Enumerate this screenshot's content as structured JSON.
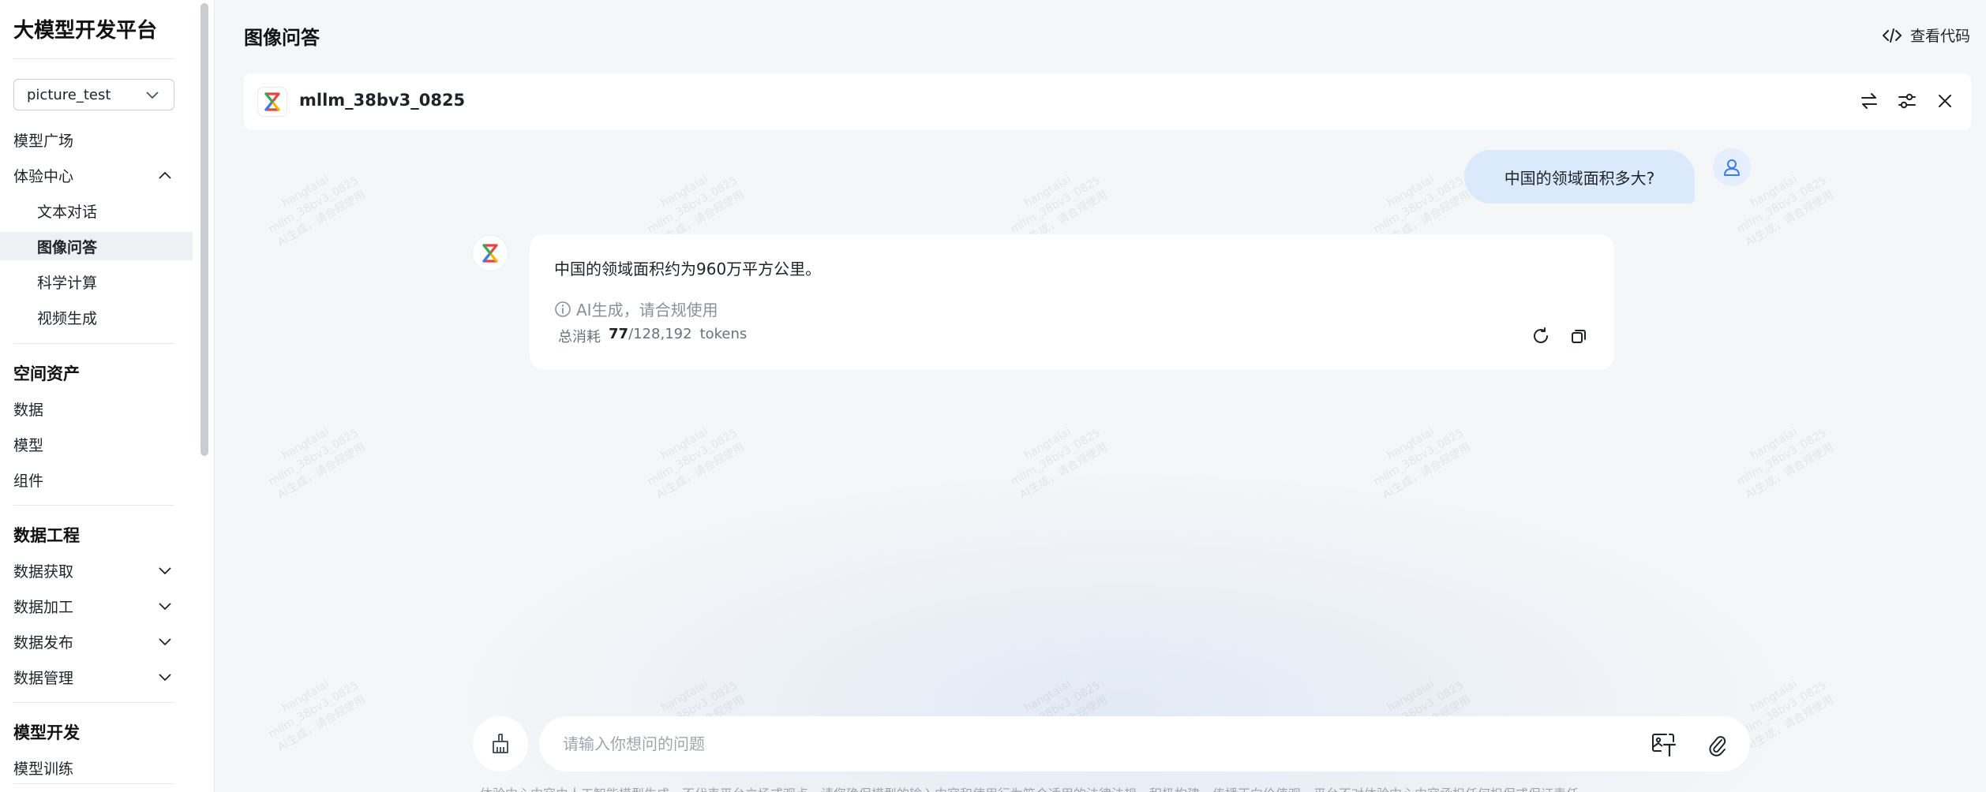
{
  "sidebar": {
    "brand": "大模型开发平台",
    "project": "picture_test",
    "items": {
      "model_square": "模型广场",
      "experience_center": "体验中心",
      "text_chat": "文本对话",
      "image_qa": "图像问答",
      "sci_compute": "科学计算",
      "video_gen": "视频生成"
    },
    "group_space": "空间资产",
    "space_items": [
      "数据",
      "模型",
      "组件"
    ],
    "group_data_eng": "数据工程",
    "data_eng_items": [
      "数据获取",
      "数据加工",
      "数据发布",
      "数据管理"
    ],
    "group_model_dev": "模型开发",
    "model_dev_items": [
      "模型训练"
    ]
  },
  "header": {
    "title": "图像问答",
    "view_code": "查看代码"
  },
  "model_bar": {
    "name": "mllm_38bv3_0825"
  },
  "watermark": {
    "line1": "hangtaiai",
    "line2": "mllm_38bv3_0825",
    "line3": "AI生成，请合规使用"
  },
  "chat": {
    "user_message": "中国的领域面积多大?",
    "answer": "中国的领域面积约为960万平方公里。",
    "ai_note": "AI生成，请合规使用",
    "tokens_label": "总消耗",
    "tokens_used": "77",
    "tokens_total": "/128,192",
    "tokens_unit": "tokens"
  },
  "input": {
    "placeholder": "请输入你想问的问题",
    "value": ""
  },
  "disclaimer": "体验中心内容由人工智能模型生成，不代表平台立场或观点，请您确保模型的输入内容和使用行为符合适用的法律法规，积极构建、传播正向价值观，平台不对体验中心内容承担任何担保或保证责任",
  "colors": {
    "user_bubble": "#dbe9fc",
    "accent_blue": "#3b7ded",
    "sidebar_active": "#eef0f3"
  }
}
